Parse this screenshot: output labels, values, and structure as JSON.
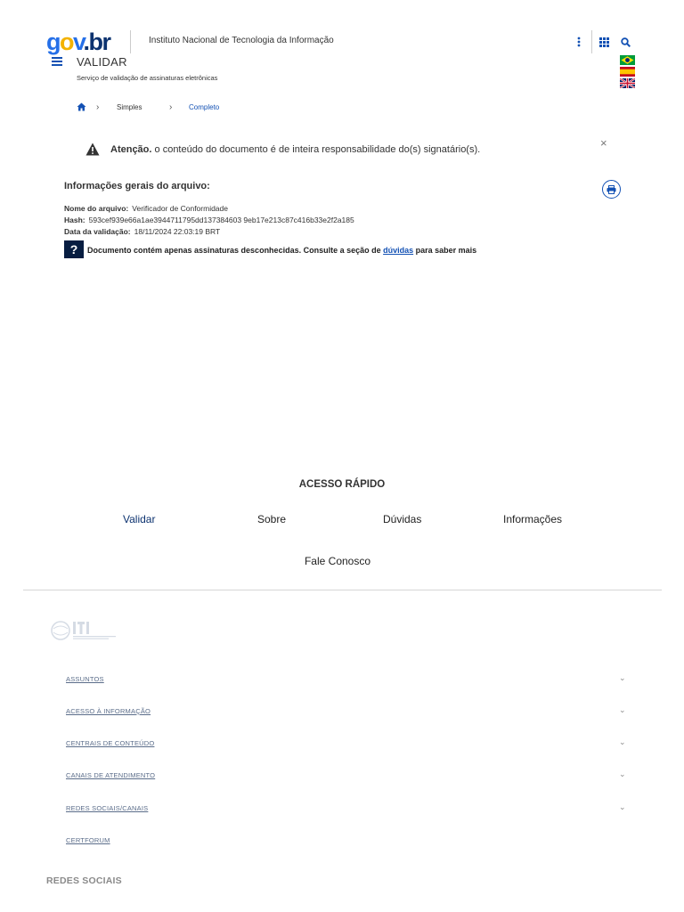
{
  "header": {
    "logo": {
      "g": "g",
      "o": "o",
      "v": "v",
      "dot": ".",
      "br": "br"
    },
    "institution": "Instituto Nacional de Tecnologia da Informação",
    "title": "VALIDAR",
    "subtitle": "Serviço de validação de assinaturas eletrônicas",
    "icons": [
      "more-vertical-icon",
      "apps-grid-icon",
      "search-icon"
    ],
    "languages": [
      "flag-brazil-icon",
      "flag-spain-icon",
      "flag-uk-icon"
    ]
  },
  "breadcrumb": {
    "items": [
      "Simples",
      "Completo"
    ]
  },
  "alert": {
    "strong": "Atenção.",
    "text": " o conteúdo do documento é de inteira responsabilidade do(s) signatário(s).",
    "close": "×"
  },
  "info": {
    "title": "Informações gerais do arquivo:",
    "rows": [
      {
        "label": "Nome do arquivo:",
        "value": "Verificador de Conformidade"
      },
      {
        "label": "Hash:",
        "value": "593cef939e66a1ae3944711795dd137384603 9eb17e213c87c416b33e2f2a185"
      },
      {
        "label": "Data da validação:",
        "value": "18/11/2024 22:03:19 BRT"
      }
    ],
    "notice_before": "Documento contém apenas assinaturas desconhecidas. Consulte a seção de ",
    "notice_link": "dúvidas",
    "notice_after": " para saber mais",
    "qmark": "?"
  },
  "quick": {
    "title": "ACESSO RÁPIDO",
    "links": [
      "Validar",
      "Sobre",
      "Dúvidas",
      "Informações"
    ],
    "fale": "Fale Conosco"
  },
  "footer": {
    "items": [
      "ASSUNTOS",
      "ACESSO À INFORMAÇÃO",
      "CENTRAIS DE CONTEÚDO",
      "CANAIS DE ATENDIMENTO",
      "REDES SOCIAIS/CANAIS",
      "CERTFORUM"
    ],
    "social_title": "REDES SOCIAIS"
  },
  "colors": {
    "primary": "#1351b4",
    "dark": "#071d41",
    "logo_yellow": "#f3b200"
  }
}
